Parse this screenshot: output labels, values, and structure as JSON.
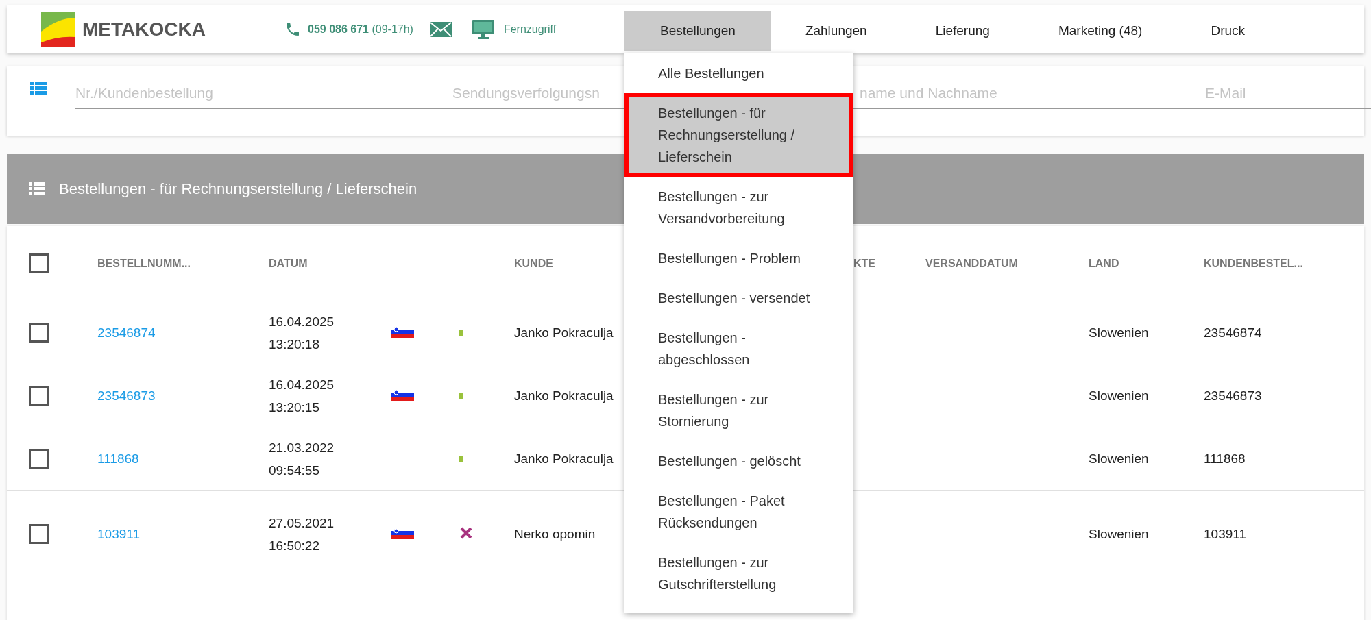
{
  "header": {
    "brand": "METAKOCKA",
    "phone": "059 086 671",
    "hours": "(09-17h)",
    "remote": "Fernzugriff"
  },
  "nav": [
    {
      "label": "Bestellungen",
      "selected": true
    },
    {
      "label": "Zahlungen",
      "selected": false
    },
    {
      "label": "Lieferung",
      "selected": false
    },
    {
      "label": "Marketing (48)",
      "selected": false
    },
    {
      "label": "Druck",
      "selected": false
    }
  ],
  "dropdown": [
    {
      "label": "Alle Bestellungen",
      "selected": false
    },
    {
      "label": "Bestellungen - für Rechnungserstellung / Lieferschein",
      "selected": true
    },
    {
      "label": "Bestellungen - zur Versandvorbereitung",
      "selected": false
    },
    {
      "label": "Bestellungen - Problem",
      "selected": false
    },
    {
      "label": "Bestellungen - versendet",
      "selected": false
    },
    {
      "label": "Bestellungen - abgeschlossen",
      "selected": false
    },
    {
      "label": "Bestellungen - zur Stornierung",
      "selected": false
    },
    {
      "label": "Bestellungen - gelöscht",
      "selected": false
    },
    {
      "label": "Bestellungen - Paket Rücksendungen",
      "selected": false
    },
    {
      "label": "Bestellungen - zur Gutschrifterstellung",
      "selected": false
    }
  ],
  "search": [
    {
      "placeholder": "Nr./Kundenbestellung"
    },
    {
      "placeholder": "Sendungsverfolgungsn"
    },
    {
      "placeholder": "name und Nachname"
    },
    {
      "placeholder": "E-Mail"
    }
  ],
  "section": {
    "title": "Bestellungen - für Rechnungserstellung / Lieferschein"
  },
  "table": {
    "select_all": {
      "checked": false
    },
    "columns": [
      "BESTELLNUMM...",
      "DATUM",
      "",
      "",
      "KUNDE",
      "KTE",
      "VERSANDDATUM",
      "LAND",
      "KUNDENBESTEL..."
    ],
    "rows": [
      {
        "checked": false,
        "number": "23546874",
        "date": "16.04.2025",
        "time": "13:20:18",
        "flag": true,
        "kind": "ok",
        "customer": "Janko Pokraculja",
        "country": "Slowenien",
        "customer_order": "23546874"
      },
      {
        "checked": false,
        "number": "23546873",
        "date": "16.04.2025",
        "time": "13:20:15",
        "flag": true,
        "kind": "ok",
        "customer": "Janko Pokraculja",
        "country": "Slowenien",
        "customer_order": "23546873"
      },
      {
        "checked": false,
        "number": "111868",
        "date": "21.03.2022",
        "time": "09:54:55",
        "flag": false,
        "kind": "ok",
        "customer": "Janko Pokraculja",
        "country": "Slowenien",
        "customer_order": "111868"
      },
      {
        "checked": false,
        "number": "103911",
        "date": "27.05.2021",
        "time": "16:50:22",
        "flag": true,
        "kind": "error",
        "customer": "Nerko opomin",
        "country": "Slowenien",
        "customer_order": "103911"
      }
    ]
  }
}
